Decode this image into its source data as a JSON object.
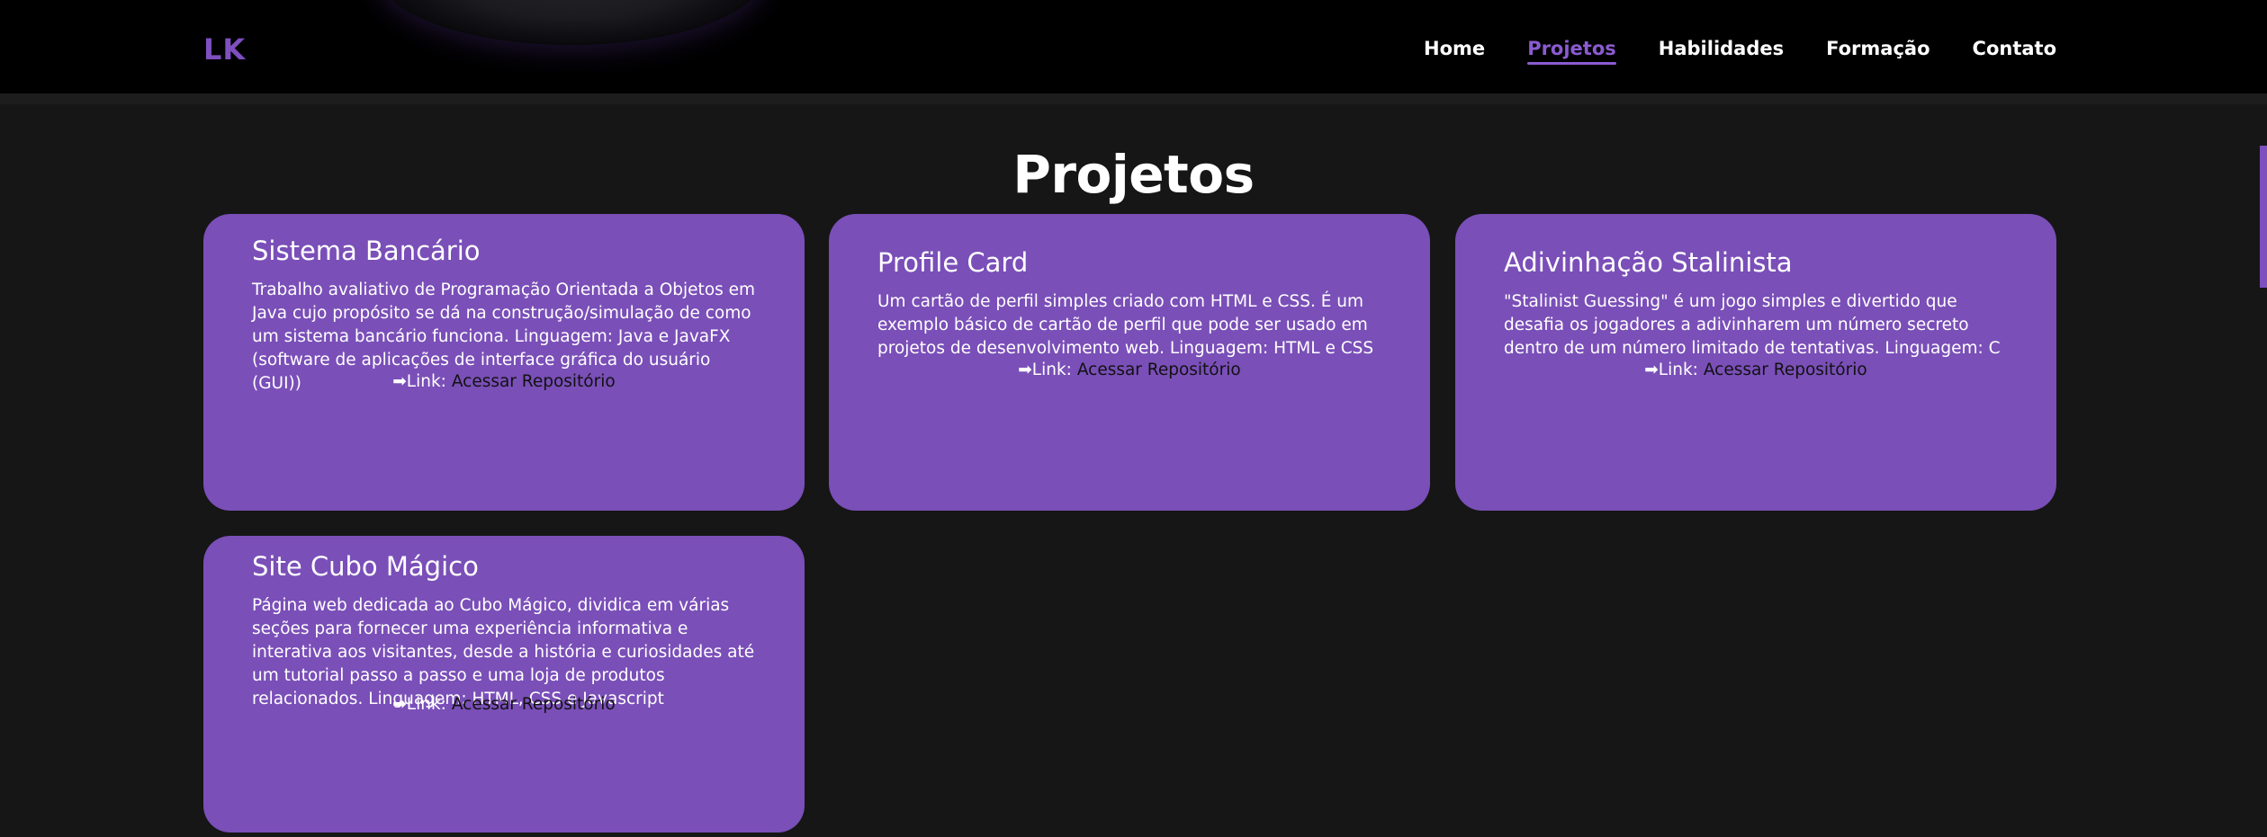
{
  "header": {
    "logo": "LK",
    "nav": [
      {
        "label": "Home"
      },
      {
        "label": "Projetos",
        "active": true
      },
      {
        "label": "Habilidades"
      },
      {
        "label": "Formação"
      },
      {
        "label": "Contato"
      }
    ]
  },
  "section_title": "Projetos",
  "projects": [
    {
      "title": "Sistema Bancário",
      "description": "Trabalho avaliativo de Programação Orientada a Objetos em Java cujo propósito se dá na construção/simulação de como um sistema bancário funciona. Linguagem: Java e JavaFX (software de aplicações de interface gráfica do usuário (GUI))",
      "link_prefix": "➡Link:",
      "link_text": "Acessar Repositório"
    },
    {
      "title": "Profile Card",
      "description": "Um cartão de perfil simples criado com HTML e CSS. É um exemplo básico de cartão de perfil que pode ser usado em projetos de desenvolvimento web. Linguagem: HTML e CSS",
      "link_prefix": "➡Link:",
      "link_text": "Acessar Repositório"
    },
    {
      "title": "Adivinhação Stalinista",
      "description": "\"Stalinist Guessing\" é um jogo simples e divertido que desafia os jogadores a adivinharem um número secreto dentro de um número limitado de tentativas. Linguagem: C",
      "link_prefix": "➡Link:",
      "link_text": "Acessar Repositório"
    },
    {
      "title": "Site Cubo Mágico",
      "description": "Página web dedicada ao Cubo Mágico, dividica em várias seções para fornecer uma experiência informativa e interativa aos visitantes, desde a história e curiosidades até um tutorial passo a passo e uma loja de produtos relacionados. Linguagem: HTML, CSS e Javascript",
      "link_prefix": "➡Link:",
      "link_text": "Acessar Repositório"
    }
  ],
  "colors": {
    "accent": "#7d4fbf",
    "card": "#7a4fb8",
    "background": "#161616",
    "header": "#000000"
  }
}
